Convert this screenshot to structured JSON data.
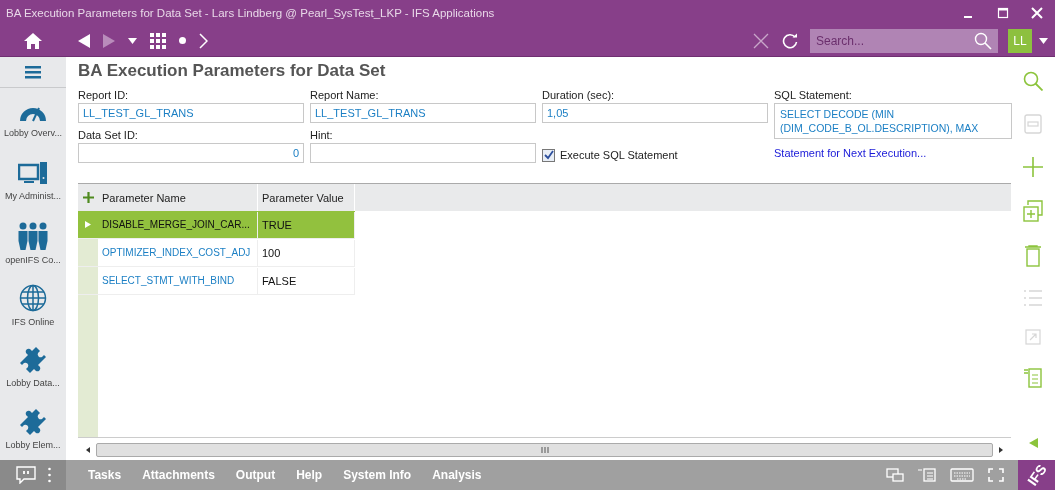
{
  "window": {
    "title": "BA Execution Parameters for Data Set - Lars Lindberg @ Pearl_SysTest_LKP - IFS Applications"
  },
  "search": {
    "placeholder": "Search..."
  },
  "user": {
    "initials": "LL"
  },
  "sidebar": {
    "items": [
      {
        "label": "Lobby Overv...",
        "kind": "gauge"
      },
      {
        "label": "My Administ...",
        "kind": "computer"
      },
      {
        "label": "openIFS Co...",
        "kind": "people"
      },
      {
        "label": "IFS Online",
        "kind": "globe"
      },
      {
        "label": "Lobby Data...",
        "kind": "puzzle"
      },
      {
        "label": "Lobby Elem...",
        "kind": "puzzle"
      }
    ]
  },
  "page": {
    "title": "BA Execution Parameters for Data Set"
  },
  "form": {
    "fields": [
      {
        "label": "Report ID:",
        "value": "LL_TEST_GL_TRANS",
        "kind": "text"
      },
      {
        "label": "Report Name:",
        "value": "LL_TEST_GL_TRANS",
        "kind": "text"
      },
      {
        "label": "Duration (sec):",
        "value": "1,05",
        "kind": "text"
      },
      {
        "label": "Data Set ID:",
        "value": "0",
        "kind": "number"
      },
      {
        "label": "Hint:",
        "kind": "text"
      }
    ],
    "sql": {
      "label": "SQL Statement:",
      "value": "SELECT DECODE (MIN (DIM_CODE_B_OL.DESCRIPTION), MAX"
    },
    "execute": {
      "label": "Execute SQL Statement",
      "checked": true
    },
    "link": "Statement for Next Execution..."
  },
  "table": {
    "columns": [
      "Parameter Name",
      "Parameter Value"
    ],
    "rows": [
      {
        "name": "DISABLE_MERGE_JOIN_CAR...",
        "value": "TRUE",
        "selected": true
      },
      {
        "name": "OPTIMIZER_INDEX_COST_ADJ",
        "value": "100",
        "selected": false
      },
      {
        "name": "SELECT_STMT_WITH_BIND",
        "value": "FALSE",
        "selected": false
      }
    ]
  },
  "toolbar": [
    {
      "kind": "search",
      "disabled": false
    },
    {
      "kind": "save",
      "disabled": true
    },
    {
      "kind": "add",
      "disabled": false
    },
    {
      "kind": "duplicate",
      "disabled": false
    },
    {
      "kind": "delete",
      "disabled": false
    },
    {
      "kind": "list",
      "disabled": true
    },
    {
      "kind": "open",
      "disabled": true
    },
    {
      "kind": "details",
      "disabled": false
    }
  ],
  "bottom_menu": [
    "Tasks",
    "Attachments",
    "Output",
    "Help",
    "System Info",
    "Analysis"
  ],
  "logo": "IFS"
}
